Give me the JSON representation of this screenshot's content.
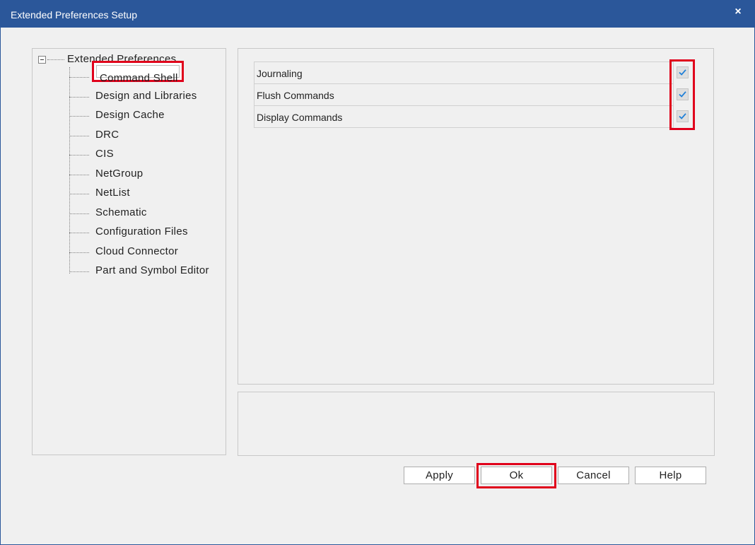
{
  "window": {
    "title": "Extended Preferences Setup",
    "close_glyph": "×",
    "accent_color": "#2b579a",
    "highlight_color": "#e0001b"
  },
  "tree": {
    "root_label": "Extended Preferences",
    "expanded": true,
    "selected_index": 0,
    "items": [
      {
        "label": "Command Shell"
      },
      {
        "label": "Design and Libraries"
      },
      {
        "label": "Design Cache"
      },
      {
        "label": "DRC"
      },
      {
        "label": "CIS"
      },
      {
        "label": "NetGroup"
      },
      {
        "label": "NetList"
      },
      {
        "label": "Schematic"
      },
      {
        "label": "Configuration Files"
      },
      {
        "label": "Cloud Connector"
      },
      {
        "label": "Part and Symbol Editor"
      }
    ]
  },
  "settings": {
    "rows": [
      {
        "label": "Journaling",
        "checked": true
      },
      {
        "label": "Flush Commands",
        "checked": true
      },
      {
        "label": "Display Commands",
        "checked": true
      }
    ]
  },
  "buttons": {
    "apply": "Apply",
    "ok": "Ok",
    "cancel": "Cancel",
    "help": "Help"
  },
  "icons": {
    "expander": "minus-box-icon",
    "checkbox": "checkmark-icon",
    "close": "close-icon"
  }
}
